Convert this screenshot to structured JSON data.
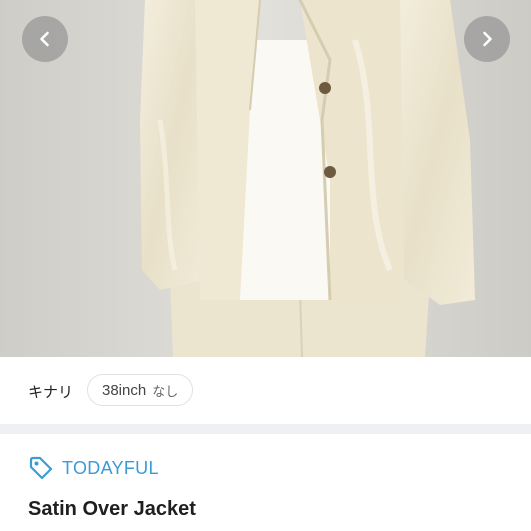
{
  "product": {
    "color_option": "キナリ",
    "size_value": "38inch",
    "size_note": "なし",
    "brand_name": "TODAYFUL",
    "title": "Satin Over Jacket"
  },
  "icons": {
    "prev": "chevron-left-icon",
    "next": "chevron-right-icon",
    "brand": "tag-icon"
  },
  "colors": {
    "brand_accent": "#3a9bd9",
    "photo_bg": "#d8d6d0",
    "garment": "#efe9d6"
  }
}
